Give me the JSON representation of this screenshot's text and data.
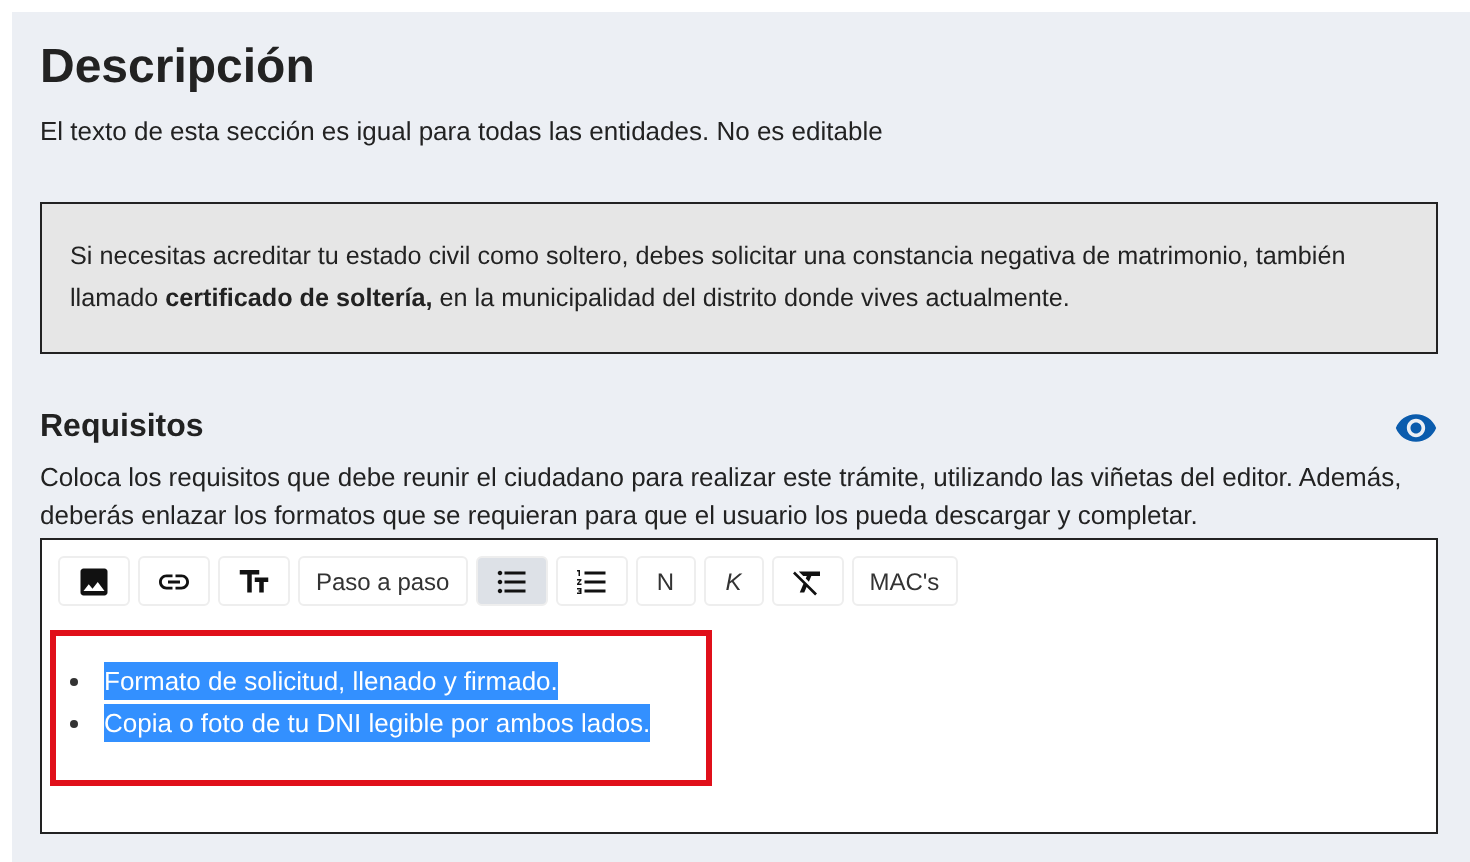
{
  "description": {
    "title": "Descripción",
    "subtitle": "El texto de esta sección es igual para todas las entidades. No es editable",
    "notice": "Si necesitas acreditar tu estado civil como soltero, debes solicitar una constancia negativa de matrimonio, también llamado **certificado de soltería,** en la municipalidad del distrito donde vives actualmente."
  },
  "requirements": {
    "title": "Requisitos",
    "help": "Coloca los requisitos que debe reunir el ciudadano para realizar este trámite, utilizando las viñetas del editor. Además, deberás enlazar los formatos que se requieran para que el usuario los pueda descargar y completar.",
    "toolbar": [
      {
        "kind": "image",
        "selected": false
      },
      {
        "kind": "link",
        "selected": false
      },
      {
        "kind": "text-size",
        "selected": false
      },
      {
        "kind": "text",
        "label": "Paso a paso",
        "selected": false
      },
      {
        "kind": "bullet-list",
        "selected": true
      },
      {
        "kind": "numbered-list",
        "selected": false
      },
      {
        "kind": "text",
        "label": "N",
        "selected": false
      },
      {
        "kind": "italic",
        "label": "K",
        "selected": false
      },
      {
        "kind": "clear-format",
        "selected": false
      },
      {
        "kind": "text",
        "label": "MAC's",
        "selected": false
      }
    ],
    "items": [
      {
        "text": "Formato de solicitud, llenado y firmado.",
        "highlighted": true
      },
      {
        "text": "Copia o foto de tu DNI legible por ambos lados.",
        "highlighted": true
      }
    ]
  }
}
